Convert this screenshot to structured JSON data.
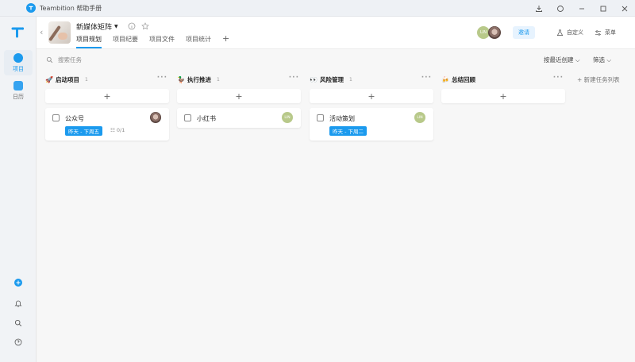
{
  "window": {
    "title": "Teambition 帮助手册",
    "controls": [
      "download-icon",
      "sync-icon",
      "minimize-icon",
      "maximize-icon",
      "close-icon"
    ]
  },
  "rail": {
    "items": [
      {
        "label": "项目",
        "icon": "project-icon",
        "active": true
      },
      {
        "label": "日历",
        "icon": "calendar-icon",
        "active": false
      }
    ],
    "bottom_icons": [
      "add-icon",
      "bell-icon",
      "search-icon",
      "help-icon"
    ]
  },
  "header": {
    "project_name": "新媒体矩阵",
    "tabs": [
      {
        "label": "项目规划",
        "active": true
      },
      {
        "label": "项目纪要",
        "active": false
      },
      {
        "label": "项目文件",
        "active": false
      },
      {
        "label": "项目统计",
        "active": false
      }
    ],
    "member_badge": "LIN",
    "invite_label": "邀请",
    "customize_label": "自定义",
    "menu_label": "菜单"
  },
  "toolbar": {
    "search_placeholder": "搜索任务",
    "sort_label": "按最近创建 ⌵",
    "filter_label": "筛选 ⌵"
  },
  "columns": [
    {
      "name": "启动项目",
      "icon": "rocket-icon",
      "emoji": "🚀",
      "count": "1",
      "cards": [
        {
          "title": "公众号",
          "due": "昨天 - 下周五",
          "subtasks": "☷ 0/1",
          "assignee": "photo"
        }
      ]
    },
    {
      "name": "执行推进",
      "icon": "duck-icon",
      "emoji": "🦆",
      "count": "1",
      "cards": [
        {
          "title": "小红书",
          "due": "",
          "subtasks": "",
          "assignee": "LIN"
        }
      ]
    },
    {
      "name": "风险管理",
      "icon": "eyes-icon",
      "emoji": "👀",
      "count": "1",
      "cards": [
        {
          "title": "活动策划",
          "due": "昨天 - 下周二",
          "subtasks": "",
          "assignee": "LIN"
        }
      ]
    },
    {
      "name": "总结回顾",
      "icon": "cheers-icon",
      "emoji": "🍻",
      "count": "",
      "cards": []
    }
  ],
  "new_column_label": "+ 新建任务列表",
  "colors": {
    "accent": "#1b9aee",
    "avatar_lib": "#b8c98a"
  }
}
